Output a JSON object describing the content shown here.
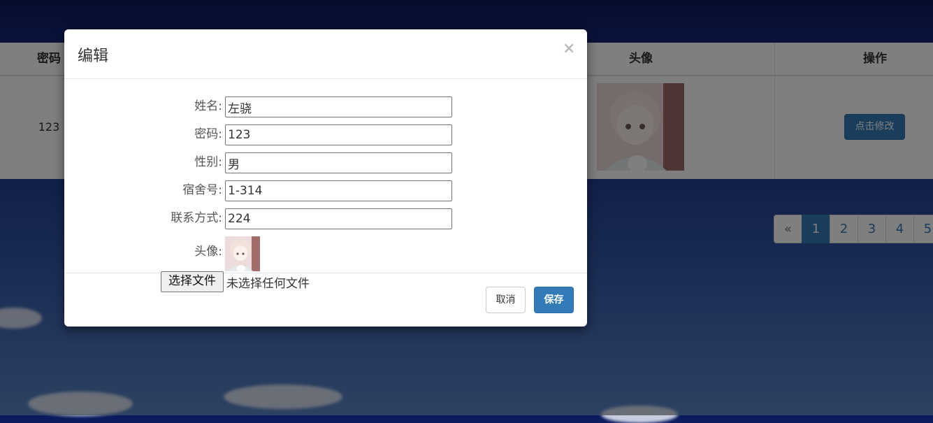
{
  "table": {
    "headers": {
      "password": "密码",
      "avatar": "头像",
      "action": "操作"
    },
    "row": {
      "password": "123",
      "action_label": "点击修改"
    }
  },
  "pagination": {
    "prev": "«",
    "pages": [
      "1",
      "2",
      "3",
      "4",
      "5"
    ],
    "active": "1"
  },
  "modal": {
    "title": "编辑",
    "close": "×",
    "fields": {
      "name": {
        "label": "姓名:",
        "value": "左骁"
      },
      "password": {
        "label": "密码:",
        "value": "123"
      },
      "gender": {
        "label": "性别:",
        "value": "男"
      },
      "dorm": {
        "label": "宿舍号:",
        "value": "1-314"
      },
      "contact": {
        "label": "联系方式:",
        "value": "224"
      },
      "avatar": {
        "label": "头像:"
      }
    },
    "file": {
      "button": "选择文件",
      "status": "未选择任何文件"
    },
    "cancel_label": "取消",
    "save_label": "保存"
  },
  "colors": {
    "primary": "#337ab7",
    "backdrop": "rgba(0,0,0,0.5)"
  }
}
